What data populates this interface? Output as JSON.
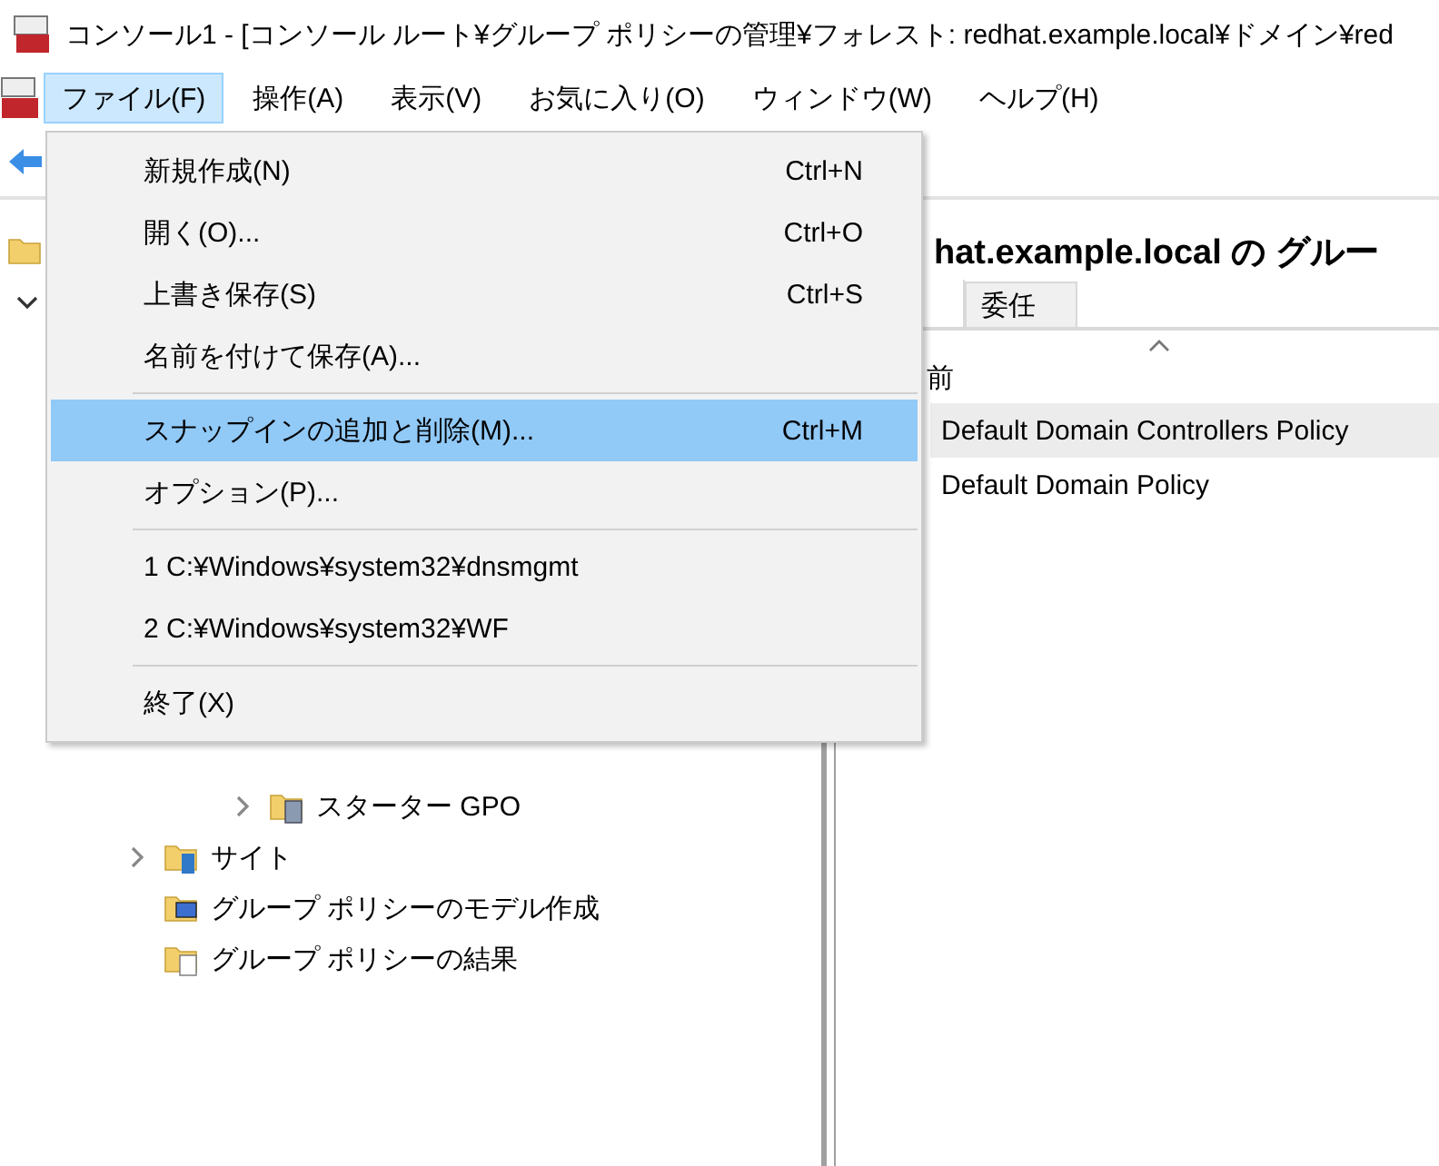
{
  "window": {
    "title": "コンソール1 - [コンソール ルート¥グループ ポリシーの管理¥フォレスト: redhat.example.local¥ドメイン¥red"
  },
  "menubar": {
    "items": [
      {
        "label": "ファイル(F)",
        "selected": true
      },
      {
        "label": "操作(A)",
        "selected": false
      },
      {
        "label": "表示(V)",
        "selected": false
      },
      {
        "label": "お気に入り(O)",
        "selected": false
      },
      {
        "label": "ウィンドウ(W)",
        "selected": false
      },
      {
        "label": "ヘルプ(H)",
        "selected": false
      }
    ]
  },
  "file_menu": {
    "items": [
      {
        "kind": "item",
        "label": "新規作成(N)",
        "shortcut": "Ctrl+N",
        "selected": false
      },
      {
        "kind": "item",
        "label": "開く(O)...",
        "shortcut": "Ctrl+O",
        "selected": false
      },
      {
        "kind": "item",
        "label": "上書き保存(S)",
        "shortcut": "Ctrl+S",
        "selected": false
      },
      {
        "kind": "item",
        "label": "名前を付けて保存(A)...",
        "selected": false
      },
      {
        "kind": "separator"
      },
      {
        "kind": "item",
        "label": "スナップインの追加と削除(M)...",
        "shortcut": "Ctrl+M",
        "selected": true
      },
      {
        "kind": "item",
        "label": "オプション(P)...",
        "selected": false
      },
      {
        "kind": "separator"
      },
      {
        "kind": "item",
        "label": "1 C:¥Windows¥system32¥dnsmgmt",
        "selected": false
      },
      {
        "kind": "item",
        "label": "2 C:¥Windows¥system32¥WF",
        "selected": false
      },
      {
        "kind": "separator"
      },
      {
        "kind": "item",
        "label": "終了(X)",
        "selected": false
      }
    ]
  },
  "tree": {
    "items": [
      {
        "kind": "folder"
      },
      {
        "expanded": true,
        "children": [
          {
            "children": [
              {
                "kind": "starter-gpo",
                "label": "スターター GPO",
                "expanded": false
              }
            ]
          },
          {
            "kind": "sites",
            "label": "サイト",
            "expanded": false
          },
          {
            "kind": "modeling",
            "label": "グループ ポリシーのモデル作成"
          },
          {
            "kind": "results",
            "label": "グループ ポリシーの結果"
          }
        ]
      }
    ]
  },
  "details": {
    "heading": "hat.example.local の グルー",
    "tabs": [
      {
        "label": "委任",
        "selected": false
      }
    ],
    "column": {
      "label": "前"
    },
    "rows": [
      {
        "label": "Default Domain Controllers Policy",
        "selected": true
      },
      {
        "label": "Default Domain Policy",
        "selected": false
      }
    ]
  }
}
